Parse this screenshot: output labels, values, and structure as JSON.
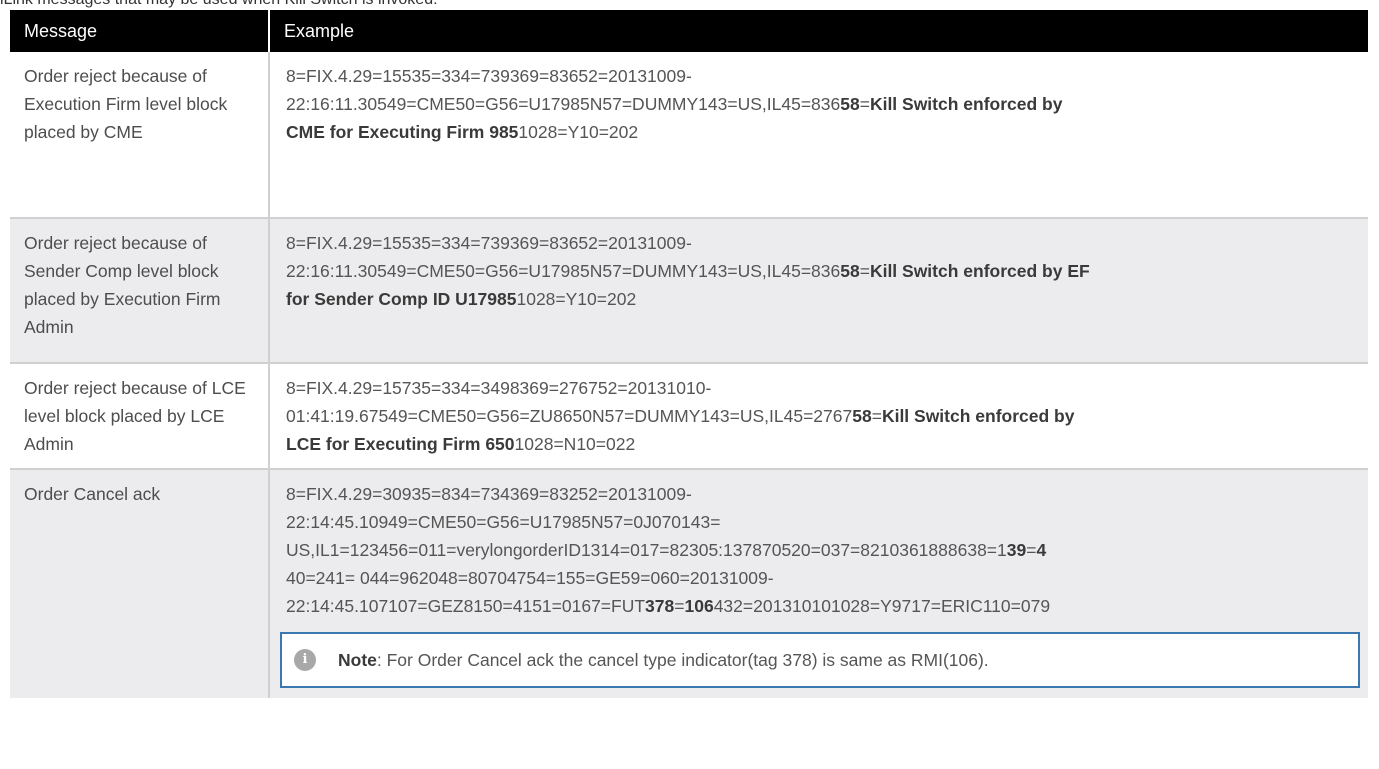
{
  "caption": "iLink messages that may be used when Kill Switch is invoked:",
  "table": {
    "headers": {
      "message": "Message",
      "example": "Example"
    },
    "rows": [
      {
        "message": "Order reject because of Execution Firm level block placed by CME",
        "lines": [
          {
            "pre": "8=FIX.4.29=15535=334=739369=83652=20131009-"
          },
          {
            "pre": "22:16:11.30549=CME50=G56=U17985N57=DUMMY143=US,IL45=836",
            "b1": "58",
            "mid": "=",
            "b2": "Kill Switch enforced by"
          },
          {
            "b1": "CME for Executing Firm 985",
            "post": "1028=Y10=202"
          }
        ]
      },
      {
        "message": "Order reject because of Sender Comp level block placed by Execution Firm Admin",
        "lines": [
          {
            "pre": "8=FIX.4.29=15535=334=739369=83652=20131009-"
          },
          {
            "pre": "22:16:11.30549=CME50=G56=U17985N57=DUMMY143=US,IL45=836",
            "b1": "58",
            "mid": "=",
            "b2": "Kill Switch enforced by EF"
          },
          {
            "b1": "for Sender Comp ID U17985",
            "post": "1028=Y10=202"
          }
        ]
      },
      {
        "message": "Order reject because of LCE level block placed by LCE Admin",
        "lines": [
          {
            "pre": "8=FIX.4.29=15735=334=3498369=276752=20131010-"
          },
          {
            "pre": "01:41:19.67549=CME50=G56=ZU8650N57=DUMMY143=US,IL45=2767",
            "b1": "58",
            "mid": "=",
            "b2": "Kill Switch enforced by"
          },
          {
            "b1": "LCE for Executing Firm 650",
            "post": "1028=N10=022"
          }
        ]
      },
      {
        "message": "Order Cancel ack",
        "lines": [
          {
            "pre": "8=FIX.4.29=30935=834=734369=83252=20131009-"
          },
          {
            "pre": "22:14:45.10949=CME50=G56=U17985N57=0J070143="
          },
          {
            "pre": "US,IL1=123456=011=verylongorderID1314=017=82305:137870520=037=8210361888638=1",
            "b1": "39",
            "mid": "=",
            "b2": "4"
          },
          {
            "pre": "40=241= 044=962048=80704754=155=GE59=060=20131009-"
          },
          {
            "pre": "22:14:45.107107=GEZ8150=4151=0167=FUT",
            "b1": "378",
            "mid": "=",
            "b2": "106",
            "post": "432=201310101028=Y9717=ERIC110=079"
          }
        ],
        "note": {
          "label": "Note",
          "text": ": For Order Cancel ack the cancel type indicator(tag 378) is same as RMI(106)."
        }
      }
    ]
  }
}
